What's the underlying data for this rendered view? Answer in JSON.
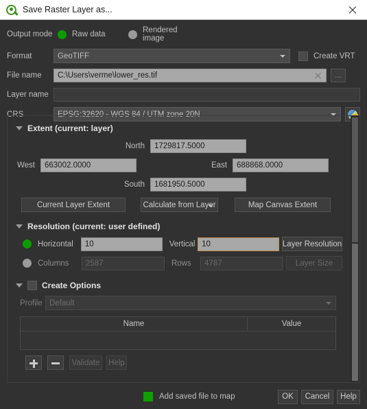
{
  "window": {
    "title": "Save Raster Layer as...",
    "logo_icon": "qgis-logo-icon",
    "close_icon": "close-icon"
  },
  "output_mode": {
    "label": "Output mode",
    "options": [
      {
        "label": "Raw data",
        "selected": true
      },
      {
        "label": "Rendered image",
        "selected": false
      }
    ],
    "selected_color": "#0e9b00",
    "unselected_color": "#9a9a9a"
  },
  "format": {
    "label": "Format",
    "value": "GeoTIFF",
    "create_vrt_label": "Create VRT",
    "create_vrt_checked": false
  },
  "file_name": {
    "label": "File name",
    "value": "C:\\Users\\verme\\lower_res.tif",
    "clear_icon": "clear-icon",
    "browse_label": "..."
  },
  "layer_name": {
    "label": "Layer name",
    "value": "",
    "placeholder": ""
  },
  "crs": {
    "label": "CRS",
    "value": "EPSG:32620 - WGS 84 / UTM zone 20N",
    "select_icon": "globe-icon"
  },
  "extent": {
    "title": "Extent (current: layer)",
    "collapse_icon": "triangle-down-icon",
    "north_label": "North",
    "north_value": "1729817.5000",
    "west_label": "West",
    "west_value": "663002.0000",
    "east_label": "East",
    "east_value": "688868.0000",
    "south_label": "South",
    "south_value": "1681950.5000",
    "buttons": {
      "current_layer_extent": "Current Layer Extent",
      "calculate_from_layer": "Calculate from Layer",
      "map_canvas_extent": "Map Canvas Extent"
    }
  },
  "resolution": {
    "title": "Resolution (current: user defined)",
    "collapse_icon": "triangle-down-icon",
    "mode_resolution_selected": true,
    "horizontal_label": "Horizontal",
    "horizontal_value": "10",
    "vertical_label": "Vertical",
    "vertical_value": "10",
    "layer_resolution_label": "Layer Resolution",
    "mode_size_selected": false,
    "columns_label": "Columns",
    "columns_value": "2587",
    "rows_label": "Rows",
    "rows_value": "4787",
    "layer_size_label": "Layer Size",
    "focus_border_color": "#c89050"
  },
  "create_options": {
    "title": "Create Options",
    "checked": false,
    "collapse_icon": "triangle-down-icon",
    "profile_label": "Profile",
    "profile_value": "Default",
    "table": {
      "columns": [
        "Name",
        "Value"
      ],
      "rows": []
    },
    "toolbar": {
      "add_icon": "plus-icon",
      "remove_icon": "minus-icon",
      "validate_label": "Validate",
      "help_label": "Help"
    }
  },
  "footer": {
    "add_saved_file_label": "Add saved file to map",
    "add_saved_file_checked": true,
    "add_saved_file_color": "#0ea000",
    "ok_label": "OK",
    "cancel_label": "Cancel",
    "help_label": "Help"
  }
}
